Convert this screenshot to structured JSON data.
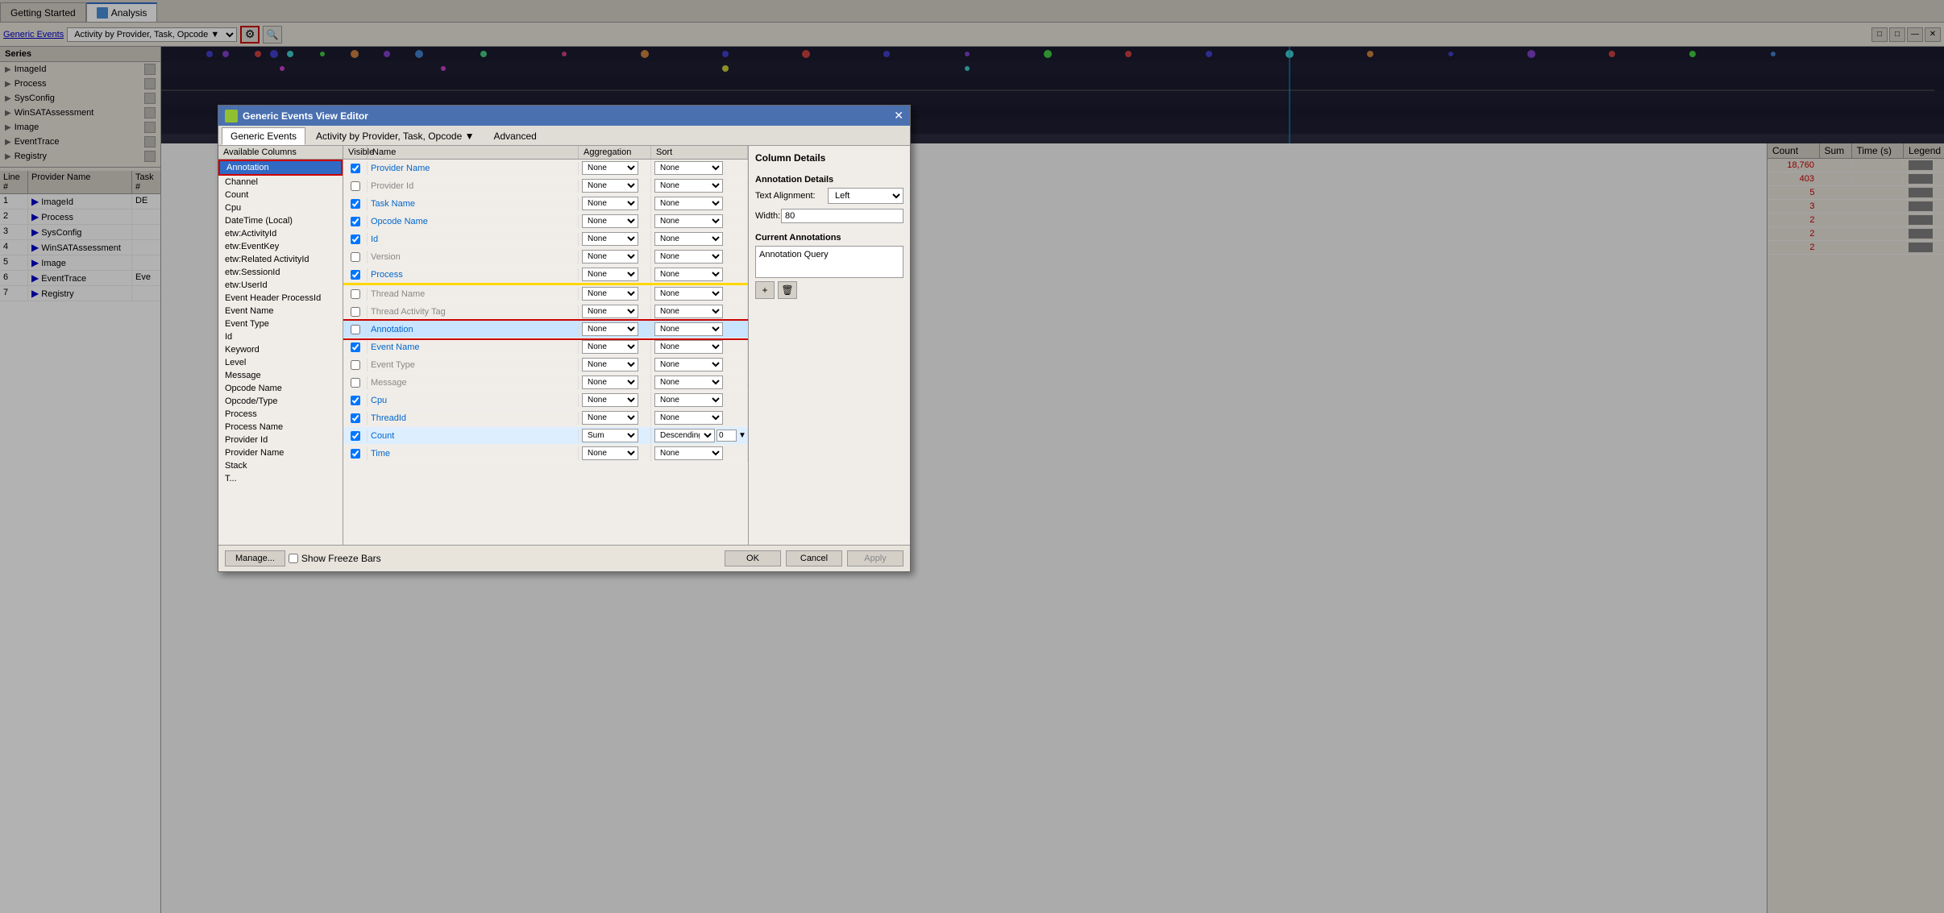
{
  "tabs": [
    {
      "label": "Getting Started",
      "active": false
    },
    {
      "label": "Analysis",
      "active": true,
      "icon": true
    }
  ],
  "toolbar": {
    "label": "Generic Events",
    "dropdown": "Activity by Provider, Task, Opcode ▼",
    "settings_label": "⚙",
    "search_label": "🔍"
  },
  "window_controls": [
    "□□",
    "□",
    "—",
    "✕"
  ],
  "series": {
    "header": "Series",
    "items": [
      {
        "label": "ImageId",
        "has_scroll": true
      },
      {
        "label": "Process",
        "has_scroll": true
      },
      {
        "label": "SysConfig",
        "has_scroll": true
      },
      {
        "label": "WinSATAssessment",
        "has_scroll": true
      },
      {
        "label": "Image",
        "has_scroll": true
      },
      {
        "label": "EventTrace",
        "has_scroll": true
      },
      {
        "label": "Registry",
        "has_scroll": true
      }
    ]
  },
  "data_table": {
    "headers": [
      "Line #",
      "Provider Name",
      "Task #"
    ],
    "rows": [
      {
        "line": "1",
        "name": "ImageId",
        "task": "DE",
        "expandable": true
      },
      {
        "line": "2",
        "name": "Process",
        "task": "",
        "expandable": true
      },
      {
        "line": "3",
        "name": "SysConfig",
        "task": "",
        "expandable": true
      },
      {
        "line": "4",
        "name": "WinSATAssessment",
        "task": "",
        "expandable": true
      },
      {
        "line": "5",
        "name": "Image",
        "task": "",
        "expandable": true
      },
      {
        "line": "6",
        "name": "EventTrace",
        "task": "Eve",
        "expandable": true
      },
      {
        "line": "7",
        "name": "Registry",
        "task": "",
        "expandable": true
      }
    ]
  },
  "right_panel": {
    "headers": [
      "Count",
      "Sum",
      "Time (s)",
      "Legend"
    ],
    "rows": [
      {
        "count": "18,760",
        "legend_color": "#808080"
      },
      {
        "count": "403",
        "legend_color": "#808080"
      },
      {
        "count": "5",
        "legend_color": "#808080"
      },
      {
        "count": "3",
        "legend_color": "#808080"
      },
      {
        "count": "2",
        "legend_color": "#808080"
      },
      {
        "count": "2",
        "legend_color": "#808080"
      },
      {
        "count": "2",
        "legend_color": "#808080"
      }
    ]
  },
  "modal": {
    "title": "Generic Events View Editor",
    "close_label": "✕",
    "tabs": [
      {
        "label": "Generic Events",
        "active": true
      },
      {
        "label": "Activity by Provider, Task, Opcode ▼",
        "active": false
      },
      {
        "label": "Advanced",
        "active": false
      }
    ],
    "available_columns_header": "Available Columns",
    "available_items": [
      {
        "label": "Annotation",
        "selected": true
      },
      {
        "label": "Channel"
      },
      {
        "label": "Count"
      },
      {
        "label": "Cpu"
      },
      {
        "label": "DateTime (Local)"
      },
      {
        "label": "etw:ActivityId"
      },
      {
        "label": "etw:EventKey"
      },
      {
        "label": "etw:Related ActivityId"
      },
      {
        "label": "etw:SessionId"
      },
      {
        "label": "etw:UserId"
      },
      {
        "label": "Event Header ProcessId"
      },
      {
        "label": "Event Name"
      },
      {
        "label": "Event Type"
      },
      {
        "label": "Id"
      },
      {
        "label": "Keyword"
      },
      {
        "label": "Level"
      },
      {
        "label": "Message"
      },
      {
        "label": "Opcode Name"
      },
      {
        "label": "Opcode/Type"
      },
      {
        "label": "Process"
      },
      {
        "label": "Process Name"
      },
      {
        "label": "Provider Id"
      },
      {
        "label": "Provider Name"
      },
      {
        "label": "Stack"
      },
      {
        "label": "T..."
      }
    ],
    "col_headers": [
      "Visible",
      "Name",
      "Aggregation",
      "Sort"
    ],
    "columns": [
      {
        "visible": true,
        "name": "Provider Name",
        "agg": "None",
        "sort": "None",
        "blue": false,
        "yellow_bottom": false
      },
      {
        "visible": false,
        "name": "Provider Id",
        "agg": "None",
        "sort": "None",
        "blue": false
      },
      {
        "visible": true,
        "name": "Task Name",
        "agg": "None",
        "sort": "None",
        "blue": false
      },
      {
        "visible": true,
        "name": "Opcode Name",
        "agg": "None",
        "sort": "None",
        "blue": false
      },
      {
        "visible": true,
        "name": "Id",
        "agg": "None",
        "sort": "None",
        "blue": false
      },
      {
        "visible": false,
        "name": "Version",
        "agg": "None",
        "sort": "None",
        "blue": false
      },
      {
        "visible": true,
        "name": "Process",
        "agg": "None",
        "sort": "None",
        "blue": false,
        "yellow_bottom": true
      },
      {
        "visible": false,
        "name": "Thread Name",
        "agg": "None",
        "sort": "None",
        "blue": false
      },
      {
        "visible": false,
        "name": "Thread Activity Tag",
        "agg": "None",
        "sort": "None",
        "blue": false
      },
      {
        "visible": false,
        "name": "Annotation",
        "agg": "None",
        "sort": "None",
        "blue": true,
        "red_border": true
      },
      {
        "visible": true,
        "name": "Event Name",
        "agg": "None",
        "sort": "None",
        "blue": false
      },
      {
        "visible": false,
        "name": "Event Type",
        "agg": "None",
        "sort": "None",
        "blue": false
      },
      {
        "visible": false,
        "name": "Message",
        "agg": "None",
        "sort": "None",
        "blue": false
      },
      {
        "visible": true,
        "name": "Cpu",
        "agg": "None",
        "sort": "None",
        "blue": false
      },
      {
        "visible": true,
        "name": "ThreadId",
        "agg": "None",
        "sort": "None",
        "blue": false
      },
      {
        "visible": true,
        "name": "Count",
        "agg": "Sum",
        "sort": "Descending",
        "sort_num": "0",
        "blue": true
      },
      {
        "visible": true,
        "name": "Time",
        "agg": "None",
        "sort": "None",
        "blue": false
      }
    ],
    "show_freeze_bars": false,
    "show_freeze_label": "Show Freeze Bars",
    "column_details": {
      "title": "Column Details",
      "annotation_details": "Annotation Details",
      "text_alignment_label": "Text Alignment:",
      "text_alignment_value": "Left",
      "width_label": "Width:",
      "width_value": "80",
      "current_annotations": "Current Annotations",
      "annotation_query": "Annotation Query",
      "add_btn": "+",
      "remove_btn": "🗑"
    },
    "footer": {
      "manage_label": "Manage...",
      "ok_label": "OK",
      "cancel_label": "Cancel",
      "apply_label": "Apply"
    }
  }
}
